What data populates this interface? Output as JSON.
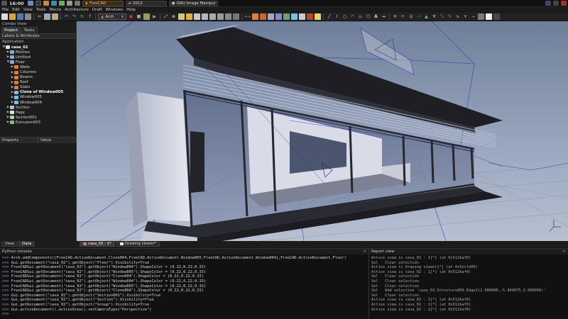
{
  "taskbar": {
    "clock": "16:00",
    "tasks": [
      {
        "label": "FreeCAD",
        "active": true
      },
      {
        "label": "2012",
        "active": false
      },
      {
        "label": "GNU Image Manipul",
        "active": false
      }
    ]
  },
  "menubar": {
    "items": [
      "File",
      "Edit",
      "View",
      "Tools",
      "Macro",
      "Architecture",
      "Draft",
      "Windows",
      "Help"
    ]
  },
  "toolbar": {
    "workbench": "Arch"
  },
  "combo": {
    "title": "Combo View",
    "tabs": [
      "Project",
      "Tasks"
    ],
    "labels_header": "Labels & Attributes",
    "application_label": "Application",
    "tree": [
      {
        "label": "casa_02",
        "depth": 0,
        "expanded": true,
        "bold": true,
        "color": "#e0e0e0"
      },
      {
        "label": "Meshes",
        "depth": 1,
        "expanded": false,
        "bold": false,
        "color": "#8aa8d8"
      },
      {
        "label": "Untitled",
        "depth": 1,
        "expanded": false,
        "bold": false,
        "color": "#8aa8d8"
      },
      {
        "label": "Floor",
        "depth": 1,
        "expanded": true,
        "bold": false,
        "color": "#8aa8d8"
      },
      {
        "label": "Walls",
        "depth": 2,
        "expanded": false,
        "bold": false,
        "color": "#e07d3a"
      },
      {
        "label": "Columns",
        "depth": 2,
        "expanded": false,
        "bold": false,
        "color": "#e07d3a"
      },
      {
        "label": "Beams",
        "depth": 2,
        "expanded": false,
        "bold": false,
        "color": "#e07d3a"
      },
      {
        "label": "Roof",
        "depth": 2,
        "expanded": false,
        "bold": false,
        "color": "#e07d3a"
      },
      {
        "label": "Slabs",
        "depth": 2,
        "expanded": false,
        "bold": false,
        "color": "#e07d3a"
      },
      {
        "label": "Clone of Window005",
        "depth": 2,
        "expanded": false,
        "bold": true,
        "color": "#7dc0e0"
      },
      {
        "label": "Window005",
        "depth": 2,
        "expanded": false,
        "bold": false,
        "color": "#7dc0e0"
      },
      {
        "label": "Window004",
        "depth": 2,
        "expanded": false,
        "bold": false,
        "color": "#7dc0e0"
      },
      {
        "label": "Section",
        "depth": 1,
        "expanded": false,
        "bold": false,
        "color": "#c0c0c0"
      },
      {
        "label": "Page",
        "depth": 1,
        "expanded": false,
        "bold": false,
        "color": "#e0e0e0"
      },
      {
        "label": "Section001",
        "depth": 1,
        "expanded": false,
        "bold": false,
        "color": "#c0c0c0"
      },
      {
        "label": "Extrusion003",
        "depth": 1,
        "expanded": false,
        "bold": false,
        "color": "#80c080"
      }
    ],
    "prop_headers": [
      "Property",
      "Value"
    ],
    "bottom_tabs": [
      "View",
      "Data"
    ]
  },
  "doc_tabs": [
    {
      "label": "casa_02 : 1*",
      "active": true
    },
    {
      "label": "Drawing viewer*",
      "active": false
    }
  ],
  "python_console": {
    "title": "Python console",
    "lines": [
      {
        "prompt": ">>>",
        "text": "Arch.addComponents([FreeCAD.ActiveDocument.Clone004,FreeCAD.ActiveDocument.Window005,FreeCAD.ActiveDocument.Window004],FreeCAD.ActiveDocument.Floor)"
      },
      {
        "prompt": ">>>",
        "text": "Gui.getDocument(\"casa_02\").getObject(\"Floor\").Visibility=True"
      },
      {
        "prompt": ">>>",
        "text": "FreeCADGui.getDocument(\"casa_02\").getObject(\"Window004\").ShapeColor = (0.22,0.22,0.33)"
      },
      {
        "prompt": ">>>",
        "text": "FreeCADGui.getDocument(\"casa_02\").getObject(\"Window005\").ShapeColor = (0.22,0.22,0.33)"
      },
      {
        "prompt": ">>>",
        "text": "FreeCADGui.getDocument(\"casa_02\").getObject(\"Clone004\").ShapeColor = (0.22,0.22,0.33)"
      },
      {
        "prompt": ">>>",
        "text": "FreeCADGui.getDocument(\"casa_02\").getObject(\"Window004\").ShapeColor = (0.22,0.22,0.33)"
      },
      {
        "prompt": ">>>",
        "text": "FreeCADGui.getDocument(\"casa_02\").getObject(\"Window005\").ShapeColor = (0.22,0.22,0.33)"
      },
      {
        "prompt": ">>>",
        "text": "FreeCADGui.getDocument(\"casa_02\").getObject(\"Clone004\").ShapeColor = (0.22,0.22,0.33)"
      },
      {
        "prompt": ">>>",
        "text": "Gui.getDocument(\"casa_02\").getObject(\"Section001\").Visibility=True"
      },
      {
        "prompt": ">>>",
        "text": "Gui.getDocument(\"casa_02\").getObject(\"Section\").Visibility=True"
      },
      {
        "prompt": ">>>",
        "text": "Gui.getDocument(\"casa_02\").getObject(\"Group\").Visibility=True"
      },
      {
        "prompt": ">>>",
        "text": "Gui.activeDocument().activeView().setCameraType(\"Perspective\")"
      },
      {
        "prompt": ">>>",
        "text": ""
      }
    ]
  },
  "report_view": {
    "title": "Report view",
    "lines": [
      "Active view is casa_02 : 1[*] (at 0x512baf0)",
      "Sel   Clear selection",
      "Active view is Drawing viewer[*] (at 0x5ecld00)",
      "Active view is casa_02 : 1[*] (at 0x512baf0)",
      "Sel   Clear selection",
      "Sel   Clear selection",
      "Sel   Clear selection",
      "Sel   Add selection 'casa_02.Structure009.Edge2(2.900000,-5.904075,3.900000)'",
      "Sel   Clear selection",
      "Active view is casa_02 : 1[*] (at 0x512baf0)",
      "Active view is casa_02 : 1[*] (at 0x512baf0)",
      "Active view is casa_02 : 1[*] (at 0x512baf0)"
    ]
  },
  "colors": {
    "accent": "#e07d3a",
    "sky_top": "#74839c",
    "floor": "#a9b3c7",
    "roof_dark": "#1e1e24",
    "glass": "#8fa0c0",
    "wireframe": "#2a2aaa"
  },
  "icons": [
    "freecad-icon",
    "new-icon",
    "open-icon",
    "save-icon",
    "print-icon",
    "cut-icon",
    "copy-icon",
    "paste-icon",
    "undo-icon",
    "redo-icon",
    "refresh-icon",
    "macro-icon",
    "view-iso-icon",
    "view-front-icon",
    "view-top-icon",
    "view-right-icon",
    "axis-cross-icon",
    "nav-cube-icon"
  ]
}
